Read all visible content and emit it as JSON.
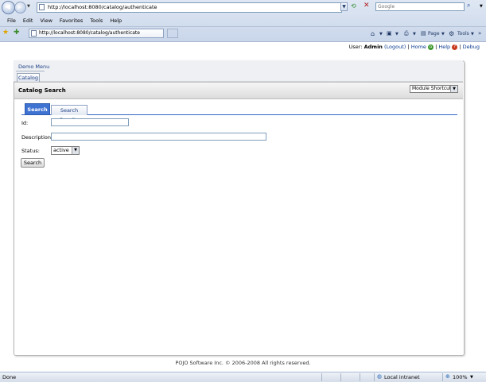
{
  "browser": {
    "url": "http://localhost:8080/catalog/authenticate",
    "search_placeholder": "Google",
    "menu": [
      "File",
      "Edit",
      "View",
      "Favorites",
      "Tools",
      "Help"
    ],
    "tab_url": "http://localhost:8080/catalog/authenticate",
    "commands": {
      "page": "Page",
      "tools": "Tools"
    },
    "status": {
      "left": "Done",
      "zone": "Local intranet",
      "zoom": "100%"
    }
  },
  "userbar": {
    "prefix": "User:",
    "user": "Admin",
    "logout": "(Logout)",
    "home": "Home",
    "help": "Help",
    "debug": "Debug"
  },
  "nav": {
    "demo_menu": "Demo Menu",
    "catalog": "Catalog"
  },
  "section": {
    "title": "Catalog Search",
    "shortcuts": "Module Shortcuts"
  },
  "tabs": {
    "search": "Search",
    "results": "Search Results"
  },
  "form": {
    "id_label": "Id:",
    "id_value": "",
    "description_label": "Description:",
    "description_value": "",
    "status_label": "Status:",
    "status_value": "active",
    "search_button": "Search"
  },
  "footer": "POJO Software Inc. © 2006-2008 All rights reserved."
}
